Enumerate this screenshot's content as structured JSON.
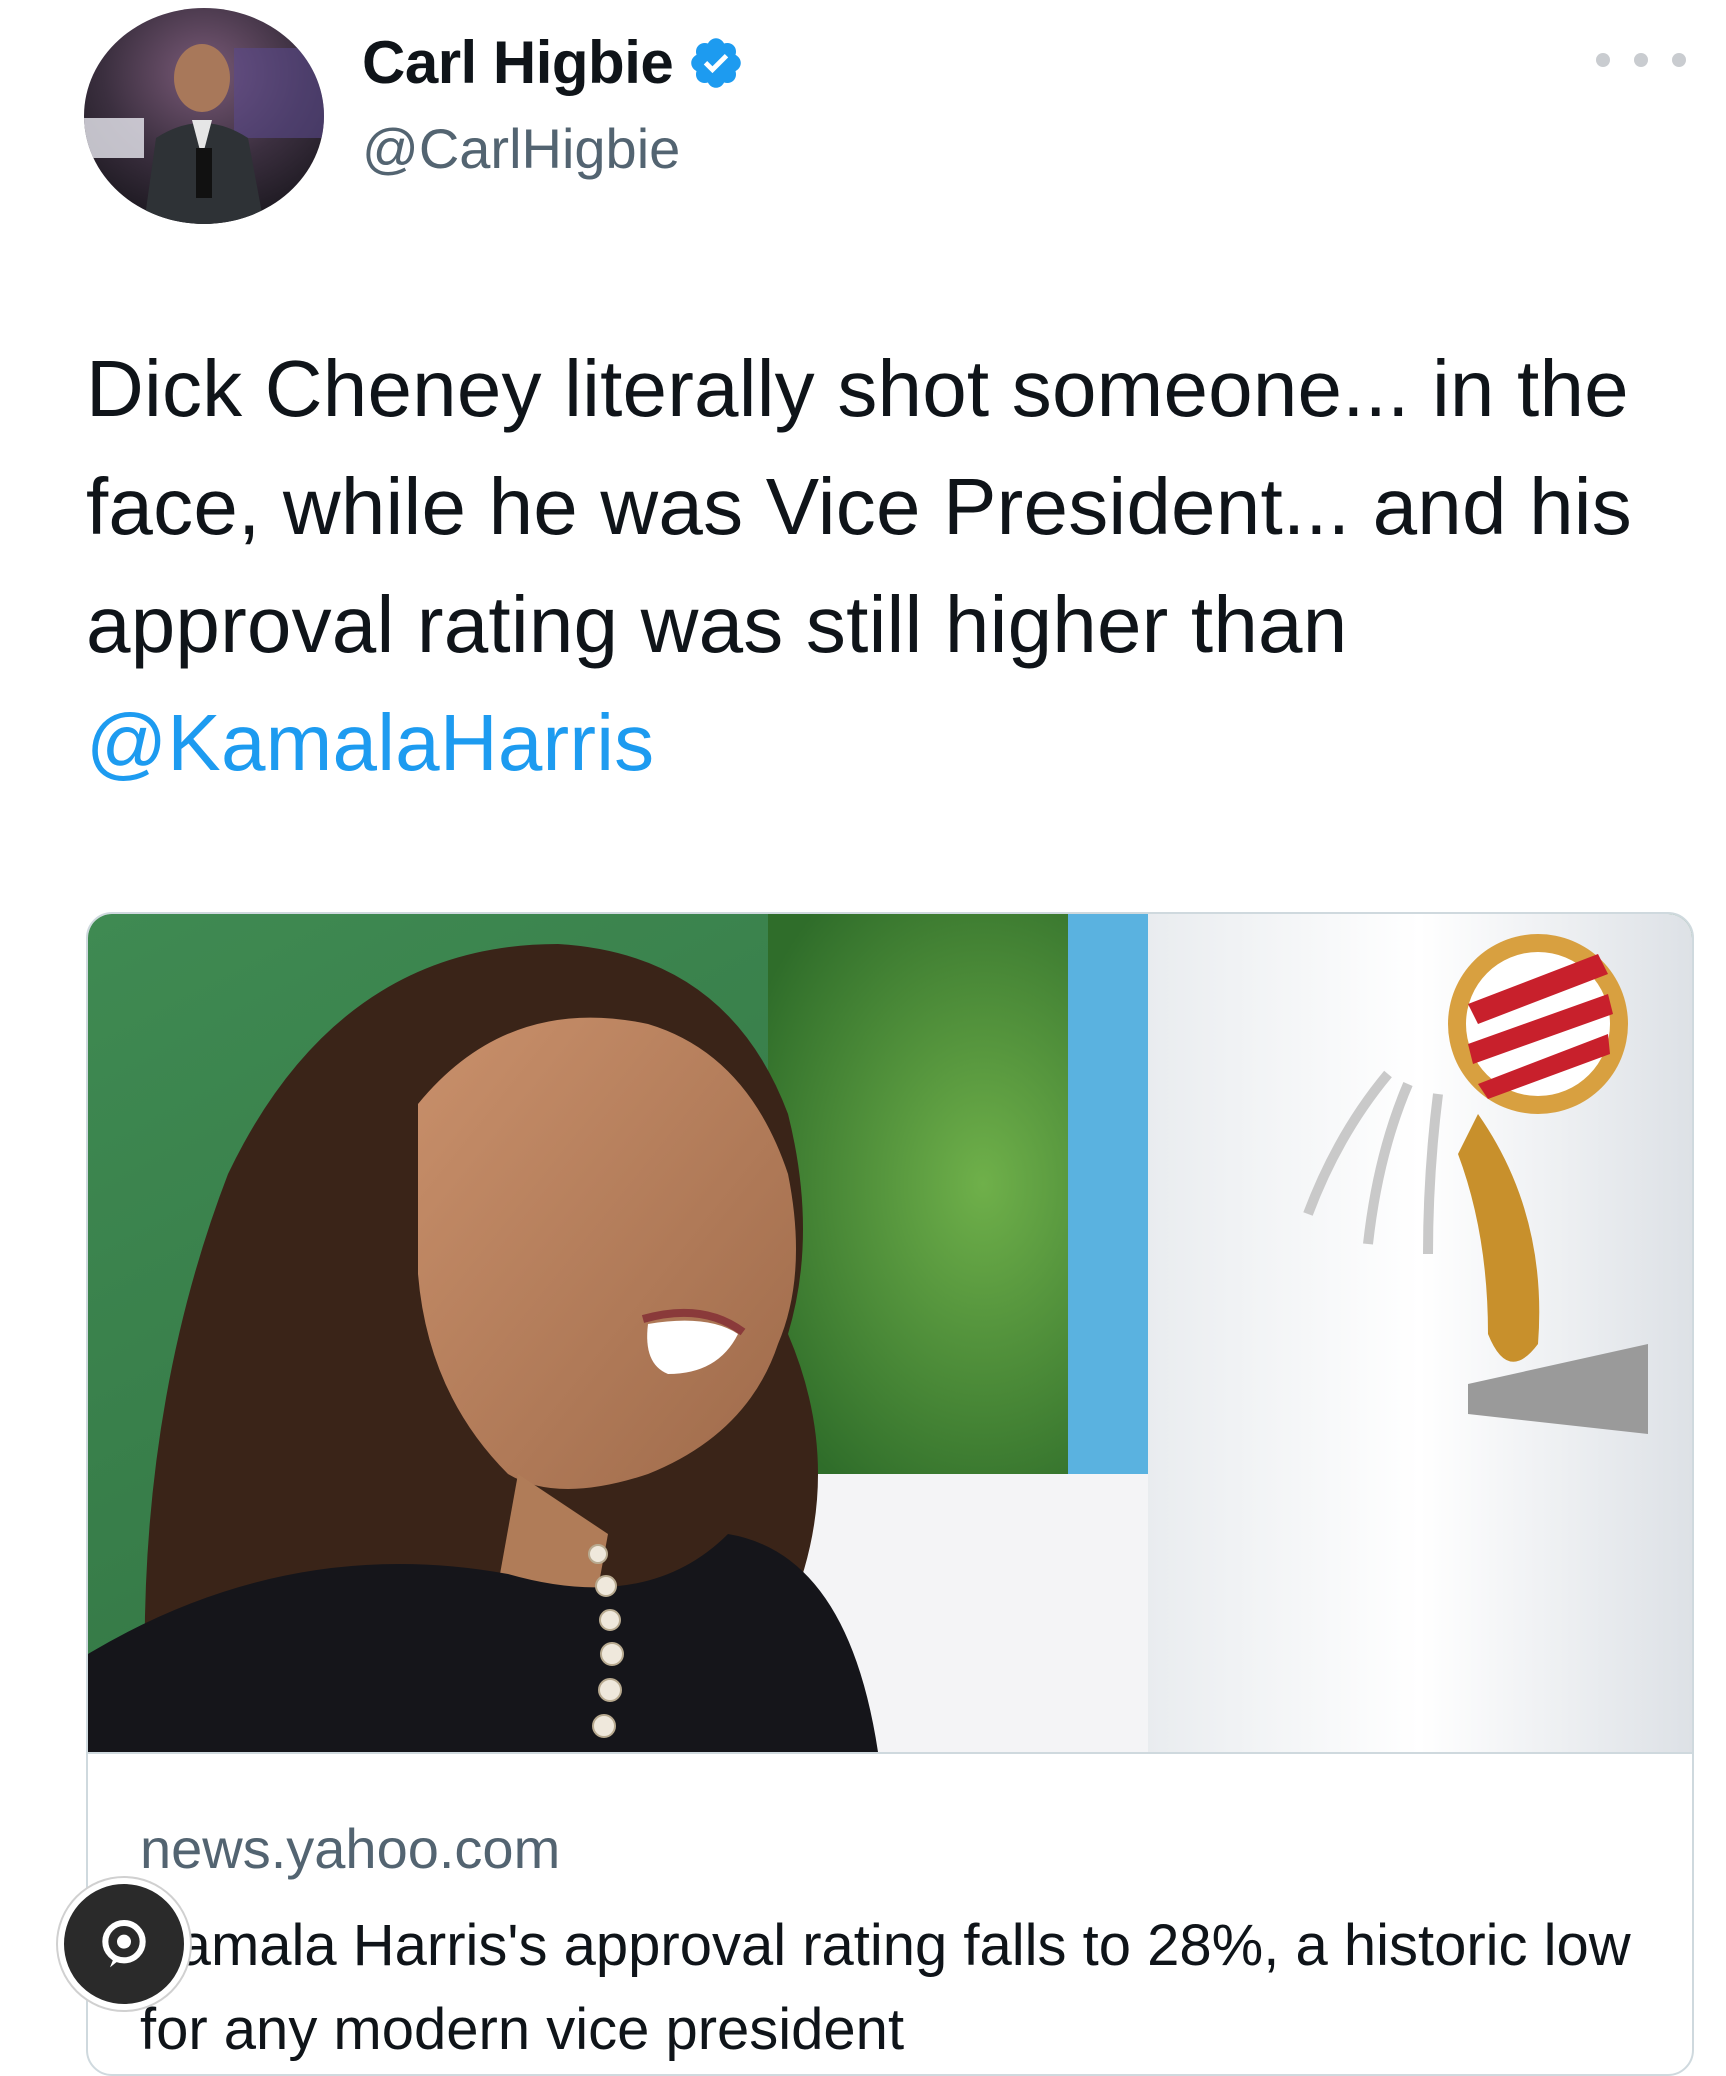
{
  "tweet": {
    "author": {
      "display_name": "Carl Higbie",
      "handle": "@CarlHigbie",
      "verified": true,
      "verified_icon": "verified-badge-icon"
    },
    "more_icon": "more-options-icon",
    "text_plain": "Dick Cheney literally shot someone... in the face, while he was Vice President... and his approval rating was still higher than ",
    "mention": "@KamalaHarris",
    "link_card": {
      "image_alt": "Kamala Harris smiling",
      "domain": "news.yahoo.com",
      "title": "Kamala Harris's approval rating falls to 28%, a historic low for any modern vice president"
    }
  },
  "overlay_badge_icon": "chat-bubble-icon",
  "colors": {
    "link": "#1d9bf0",
    "verified": "#1d9bf0",
    "secondary_text": "#536471",
    "border": "#cfd9de"
  }
}
